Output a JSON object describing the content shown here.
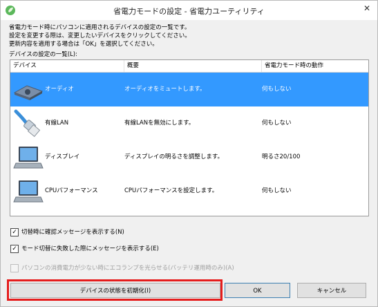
{
  "window": {
    "title": "省電力モードの設定 - 省電力ユーティリティ",
    "close_glyph": "✕"
  },
  "description": {
    "line1": "省電力モード時にパソコンに適用されるデバイスの設定の一覧です。",
    "line2": "設定を変更する際は、変更したいデバイスをクリックしてください。",
    "line3": "更新内容を適用する場合は「OK」を選択してください。"
  },
  "list": {
    "label": "デバイスの設定の一覧(L):",
    "columns": [
      "デバイス",
      "概要",
      "省電力モード時の動作"
    ],
    "rows": [
      {
        "name": "オーディオ",
        "desc": "オーディオをミュートします。",
        "action": "何もしない",
        "icon": "speaker-icon",
        "selected": true
      },
      {
        "name": "有線LAN",
        "desc": "有線LANを無効にします。",
        "action": "何もしない",
        "icon": "lan-cable-icon",
        "selected": false
      },
      {
        "name": "ディスプレイ",
        "desc": "ディスプレイの明るさを調整します。",
        "action": "明るさ20/100",
        "icon": "laptop-icon",
        "selected": false
      },
      {
        "name": "CPUパフォーマンス",
        "desc": "CPUパフォーマンスを設定します。",
        "action": "何もしない",
        "icon": "laptop-cpu-icon",
        "selected": false
      }
    ]
  },
  "options": {
    "confirm_switch": {
      "label": "切替時に確認メッセージを表示する(N)",
      "checked": true
    },
    "fail_message": {
      "label": "モード切替に失敗した際にメッセージを表示する(E)",
      "checked": true
    },
    "eco_lamp": {
      "label": "パソコンの消費電力が少ない時にエコランプを光らせる(バッテリ運用時のみ)(A)",
      "checked": false,
      "disabled": true
    }
  },
  "buttons": {
    "reset": "デバイスの状態を初期化(I)",
    "ok": "OK",
    "cancel": "キャンセル"
  },
  "colors": {
    "selection": "#3399ff",
    "highlight": "#e51c1c"
  }
}
